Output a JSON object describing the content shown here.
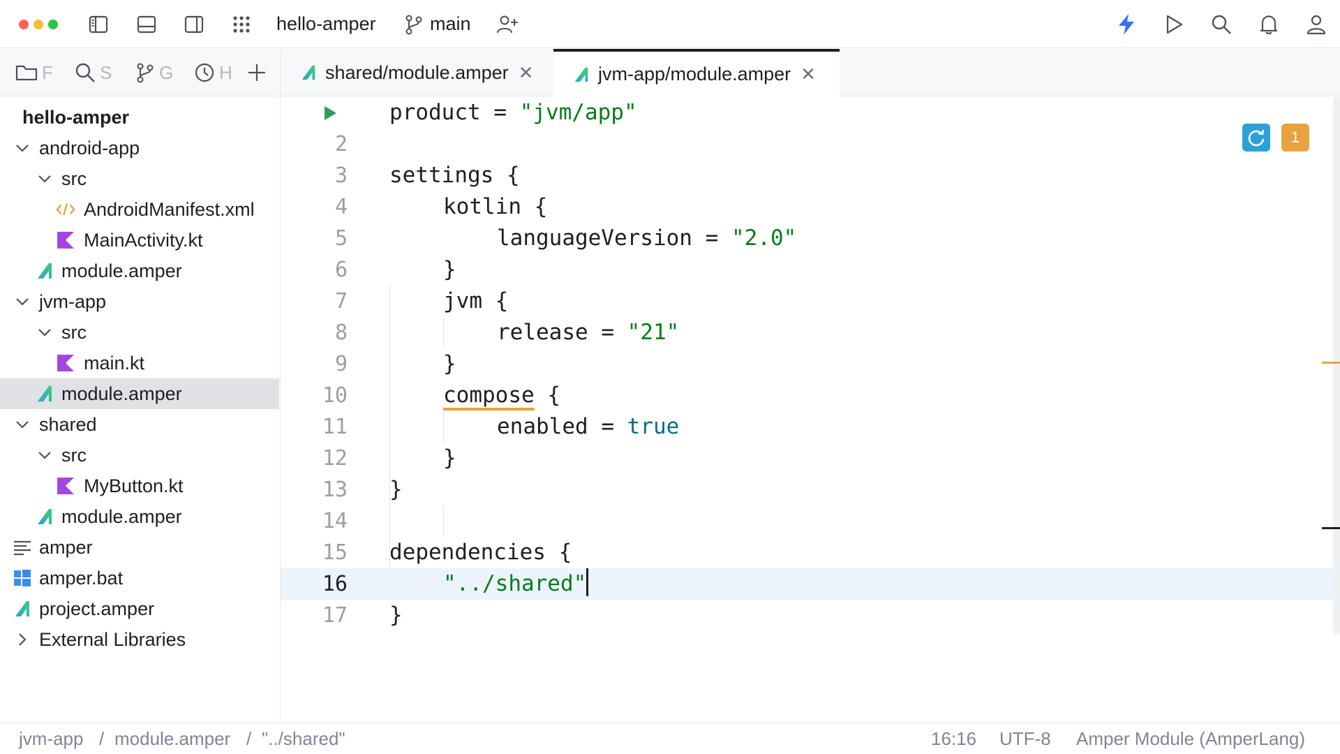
{
  "window": {
    "project_name": "hello-amper",
    "branch": "main"
  },
  "toolbar": {
    "icons": [
      "project-panel-icon",
      "bottom-panel-icon",
      "right-panel-icon",
      "apps-grid-icon",
      "git-branch-icon",
      "add-user-icon",
      "lightning-icon",
      "run-icon",
      "search-icon",
      "bell-icon",
      "profile-icon"
    ],
    "accent": "#3574f0"
  },
  "left_panel": {
    "tabs": [
      {
        "icon": "folder-icon",
        "label": "F"
      },
      {
        "icon": "search-icon",
        "label": "S"
      },
      {
        "icon": "git-icon",
        "label": "G"
      },
      {
        "icon": "history-icon",
        "label": "H"
      },
      {
        "icon": "plus-icon",
        "label": ""
      }
    ],
    "tree": [
      {
        "label": "hello-amper",
        "type": "root"
      },
      {
        "label": "android-app",
        "type": "folder",
        "expanded": true
      },
      {
        "label": "src",
        "type": "folder",
        "expanded": true
      },
      {
        "label": "AndroidManifest.xml",
        "type": "xml"
      },
      {
        "label": "MainActivity.kt",
        "type": "kotlin"
      },
      {
        "label": "module.amper",
        "type": "amper"
      },
      {
        "label": "jvm-app",
        "type": "folder",
        "expanded": true
      },
      {
        "label": "src",
        "type": "folder",
        "expanded": true
      },
      {
        "label": "main.kt",
        "type": "kotlin"
      },
      {
        "label": "module.amper",
        "type": "amper",
        "selected": true
      },
      {
        "label": "shared",
        "type": "folder",
        "expanded": true
      },
      {
        "label": "src",
        "type": "folder",
        "expanded": true
      },
      {
        "label": "MyButton.kt",
        "type": "kotlin"
      },
      {
        "label": "module.amper",
        "type": "amper"
      },
      {
        "label": "amper",
        "type": "text"
      },
      {
        "label": "amper.bat",
        "type": "windows"
      },
      {
        "label": "project.amper",
        "type": "amper"
      },
      {
        "label": "External Libraries",
        "type": "folder",
        "expanded": false
      }
    ]
  },
  "editor": {
    "tabs": [
      {
        "label": "shared/module.amper",
        "active": false
      },
      {
        "label": "jvm-app/module.amper",
        "active": true
      }
    ],
    "line_numbers": [
      "",
      "2",
      "3",
      "4",
      "5",
      "6",
      "7",
      "8",
      "9",
      "10",
      "11",
      "12",
      "13",
      "14",
      "15",
      "16",
      "17"
    ],
    "current_line": 16,
    "code": {
      "l1_key": "product",
      "l1_eq": " = ",
      "l1_val": "\"jvm/app\"",
      "l3": "settings {",
      "l4": "kotlin {",
      "l5_key": "languageVersion",
      "l5_eq": " = ",
      "l5_val": "\"2.0\"",
      "l6": "}",
      "l7": "jvm {",
      "l8_key": "release",
      "l8_eq": " = ",
      "l8_val": "\"21\"",
      "l9": "}",
      "l10_kw": "compose",
      "l10_rest": " {",
      "l11_key": "enabled",
      "l11_eq": " = ",
      "l11_val": "true",
      "l12": "}",
      "l13": "}",
      "l15": "dependencies {",
      "l16_val": "\"../shared\"",
      "l17": "}"
    },
    "warning_count": "1",
    "colors": {
      "string": "#067d17",
      "keyword_bool": "#0b6b8a",
      "warning": "#e8a33d",
      "sync_badge": "#2ba2d7"
    }
  },
  "statusbar": {
    "breadcrumb": [
      "jvm-app",
      "module.amper",
      "\"../shared\""
    ],
    "separator": "/",
    "position": "16:16",
    "encoding": "UTF-8",
    "file_type": "Amper Module (AmperLang)"
  }
}
